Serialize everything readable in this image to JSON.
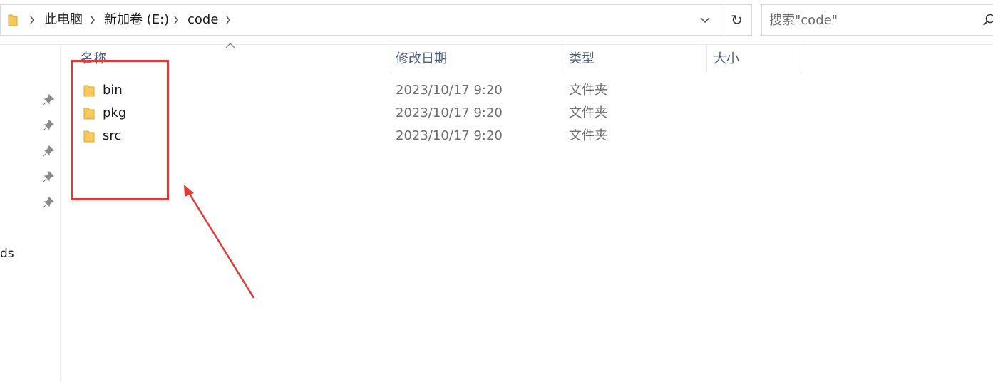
{
  "address_bar": {
    "breadcrumbs": [
      "此电脑",
      "新加卷 (E:)",
      "code"
    ],
    "refresh_symbol": "↻"
  },
  "search": {
    "placeholder": "搜索\"code\""
  },
  "navigation": {
    "partial_label": "ds",
    "pinned_count": 5
  },
  "columns": [
    "名称",
    "修改日期",
    "类型",
    "大小"
  ],
  "files": [
    {
      "name": "bin",
      "modified": "2023/10/17 9:20",
      "type": "文件夹",
      "size": ""
    },
    {
      "name": "pkg",
      "modified": "2023/10/17 9:20",
      "type": "文件夹",
      "size": ""
    },
    {
      "name": "src",
      "modified": "2023/10/17 9:20",
      "type": "文件夹",
      "size": ""
    }
  ],
  "icons": {
    "folder": "folder-icon",
    "breadcrumb_separator": "chevron-right-icon",
    "dropdown": "chevron-down-icon",
    "refresh": "refresh-icon",
    "search": "search-icon",
    "pin": "pin-icon",
    "sort": "sort-ascending-icon"
  },
  "colors": {
    "annotation": "#e53935",
    "folder": "#f6c95a",
    "header_text": "#4c607a",
    "secondary_text": "#6d6d6d"
  }
}
